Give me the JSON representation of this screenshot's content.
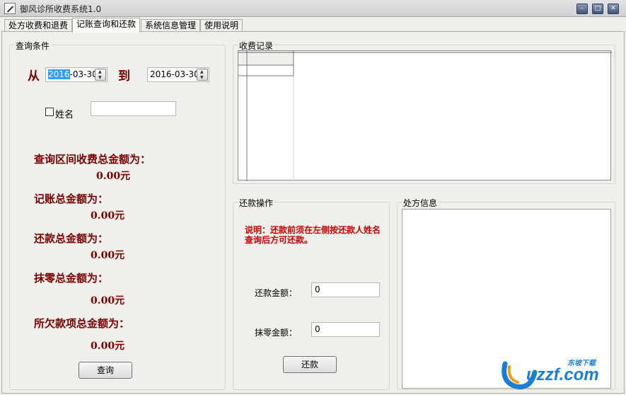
{
  "window": {
    "title": "御风诊所收费系统1.0",
    "minimize": "–",
    "maximize": "□",
    "close": "✕"
  },
  "tabs": [
    {
      "label": "处方收费和退费"
    },
    {
      "label": "记账查询和还款"
    },
    {
      "label": "系统信息管理"
    },
    {
      "label": "使用说明"
    }
  ],
  "query": {
    "group_title": "查询条件",
    "from_label": "从",
    "to_label": "到",
    "from_date_selected": "2016",
    "from_date_rest": "-03-30",
    "to_date": "2016-03-30",
    "name_checkbox_label": "姓名",
    "name_value": "",
    "total_label": "查询区间收费总金额为：",
    "total_value": "0.00元",
    "charge_label": "记账总金额为：",
    "charge_value": "0.00元",
    "repay_label": "还款总金额为：",
    "repay_value": "0.00元",
    "writeoff_label": "抹零总金额为：",
    "writeoff_value": "0.00元",
    "owed_label": "所欠款项总金额为：",
    "owed_value": "0.00元",
    "query_button": "查询"
  },
  "records": {
    "group_title": "收费记录"
  },
  "repayment": {
    "group_title": "还款操作",
    "note": "说明：还款前须在左侧按还款人姓名查询后方可还款。",
    "amount_label": "还款金额：",
    "amount_value": "0",
    "writeoff_label": "抹零金额：",
    "writeoff_value": "0",
    "repay_button": "还款"
  },
  "prescription": {
    "group_title": "处方信息"
  },
  "watermark": {
    "top": "东坡下载",
    "main": "uzzf.com"
  },
  "colors": {
    "accent_red": "#7a0000",
    "note_red": "#cc0000",
    "selection": "#3399ff",
    "watermark_blue": "#1a7fd4",
    "watermark_orange": "#f39c12"
  }
}
